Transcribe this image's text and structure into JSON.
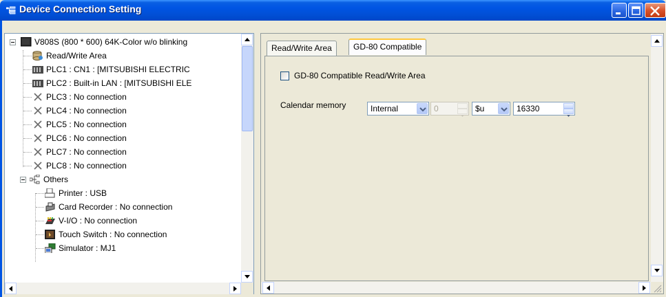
{
  "window": {
    "title": "Device Connection Setting"
  },
  "tree": {
    "items": [
      {
        "label": "V808S (800 * 600) 64K-Color w/o blinking",
        "icon": "monitor-icon"
      },
      {
        "label": "Read/Write Area",
        "icon": "database-icon"
      },
      {
        "label": "PLC1 : CN1 : [MITSUBISHI ELECTRIC",
        "icon": "plc-icon"
      },
      {
        "label": "PLC2 : Built-in LAN : [MITSUBISHI ELE",
        "icon": "plc-icon"
      },
      {
        "label": "PLC3 : No connection",
        "icon": "x-icon"
      },
      {
        "label": "PLC4 : No connection",
        "icon": "x-icon"
      },
      {
        "label": "PLC5 : No connection",
        "icon": "x-icon"
      },
      {
        "label": "PLC6 : No connection",
        "icon": "x-icon"
      },
      {
        "label": "PLC7 : No connection",
        "icon": "x-icon"
      },
      {
        "label": "PLC8 : No connection",
        "icon": "x-icon"
      },
      {
        "label": "Others",
        "icon": "network-tree-icon"
      },
      {
        "label": "Printer : USB",
        "icon": "printer-icon"
      },
      {
        "label": "Card Recorder : No connection",
        "icon": "card-recorder-icon"
      },
      {
        "label": "V-I/O : No connection",
        "icon": "vio-icon"
      },
      {
        "label": "Touch Switch : No connection",
        "icon": "touch-switch-icon"
      },
      {
        "label": "Simulator : MJ1",
        "icon": "simulator-icon"
      }
    ]
  },
  "tabs": [
    {
      "label": "Read/Write Area",
      "active": false
    },
    {
      "label": "GD-80 Compatible",
      "active": true
    }
  ],
  "gd80": {
    "checkbox_label": "GD-80 Compatible Read/Write Area",
    "checked": false,
    "calendar_label": "Calendar memory",
    "memory_select": "Internal",
    "number_value": "0",
    "device_select": "$u",
    "address_value": "16330"
  },
  "colors": {
    "title_bar": "#0054E3",
    "panel_bg": "#ECE9D8",
    "tab_highlight": "#FFC83C"
  }
}
